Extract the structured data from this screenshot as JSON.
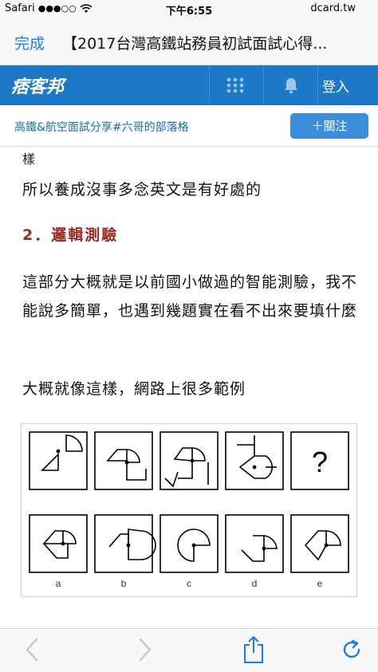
{
  "status_bar": {
    "carrier": "Safari",
    "signal": "●●●○○",
    "time": "下午6:55",
    "domain": "dcard.tw"
  },
  "safari": {
    "done_label": "完成",
    "page_title": "【2017台灣高鐵站務員初試面試心得..."
  },
  "site_header": {
    "logo_text": "痞客邦",
    "login_label": "登入"
  },
  "blog_bar": {
    "blog_name": "高鐵&航空面試分享#六哥的部落格",
    "follow_label": "＋關注"
  },
  "article": {
    "fragment": "樣",
    "paragraph_1": "所以養成沒事多念英文是有好處的",
    "heading": "2．邏輯測驗",
    "paragraph_2": "這部分大概就是以前國小做過的智能測驗，我不能說多簡單，也遇到幾題實在看不出來要填什麼",
    "paragraph_3": "大概就像這樣，網路上很多範例",
    "figure": {
      "question_mark": "?",
      "options": [
        "a",
        "b",
        "c",
        "d",
        "e"
      ]
    }
  },
  "toolbar": {
    "icons": [
      "back-icon",
      "forward-icon",
      "share-icon",
      "refresh-icon"
    ]
  },
  "colors": {
    "accent_blue": "#1a7cf2",
    "header_blue": "#1e78c8",
    "follow_blue": "#3a8edb",
    "heading_red": "#9b2c21"
  }
}
